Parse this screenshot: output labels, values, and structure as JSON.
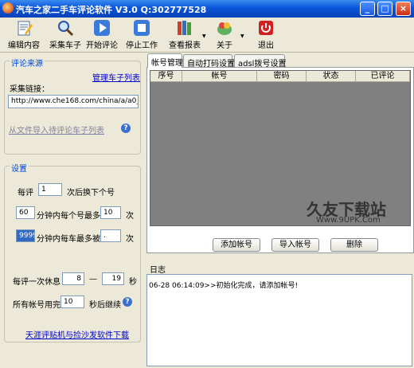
{
  "window": {
    "title": "汽车之家二手车评论软件 V3.0 Q:302777528",
    "minimize": "_",
    "maximize": "□",
    "close": "×"
  },
  "toolbar": {
    "items": [
      {
        "label": "编辑内容",
        "icon": "edit-icon"
      },
      {
        "label": "采集车子",
        "icon": "search-icon"
      },
      {
        "label": "开始评论",
        "icon": "play-icon"
      },
      {
        "label": "停止工作",
        "icon": "stop-icon"
      },
      {
        "label": "查看报表",
        "icon": "report-icon"
      },
      {
        "label": "关于",
        "icon": "about-icon"
      },
      {
        "label": "退出",
        "icon": "exit-icon"
      }
    ]
  },
  "source": {
    "group_title": "评论来源",
    "manage_link": "管理车子列表",
    "url_label": "采集链接：",
    "url_value": "http://www.che168.com/china/a/a0_0",
    "import_link": "从文件导入待评论车子列表"
  },
  "settings": {
    "group_title": "设置",
    "row1": {
      "prefix": "每评",
      "value": "1",
      "suffix": "次后换下个号"
    },
    "row2": {
      "value": "60",
      "middle": "分钟内每个号最多评",
      "value2": "10",
      "suffix": "次"
    },
    "row3": {
      "value": "9999",
      "middle": "分钟内每车最多被评",
      "value2": ".",
      "suffix": "次"
    },
    "row4": {
      "prefix": "每评一次休息",
      "min": "8",
      "dash": "—",
      "max": "19",
      "unit": "秒"
    },
    "row5": {
      "prefix": "所有帐号用完",
      "value": "10",
      "suffix": "秒后继续"
    },
    "download_link": "天涯评贴机与捡沙发软件下载"
  },
  "tabs": [
    {
      "label": "帐号管理",
      "active": true
    },
    {
      "label": "自动打码设置",
      "active": false
    },
    {
      "label": "adsl拨号设置",
      "active": false
    }
  ],
  "grid": {
    "columns": [
      "序号",
      "帐号",
      "密码",
      "状态",
      "已评论"
    ]
  },
  "account_buttons": {
    "add": "添加帐号",
    "import": "导入帐号",
    "delete": "删除"
  },
  "log": {
    "label": "日志",
    "lines": [
      "06-28 06:14:09>>初始化完成，请添加帐号!"
    ]
  },
  "watermark": {
    "main": "久友下载站",
    "sub": "Www.9UPK.Com"
  },
  "colors": {
    "title_bar": "#0a54d8",
    "group_label": "#0046d5",
    "link": "#0000c8",
    "grid_bg": "#808080"
  }
}
